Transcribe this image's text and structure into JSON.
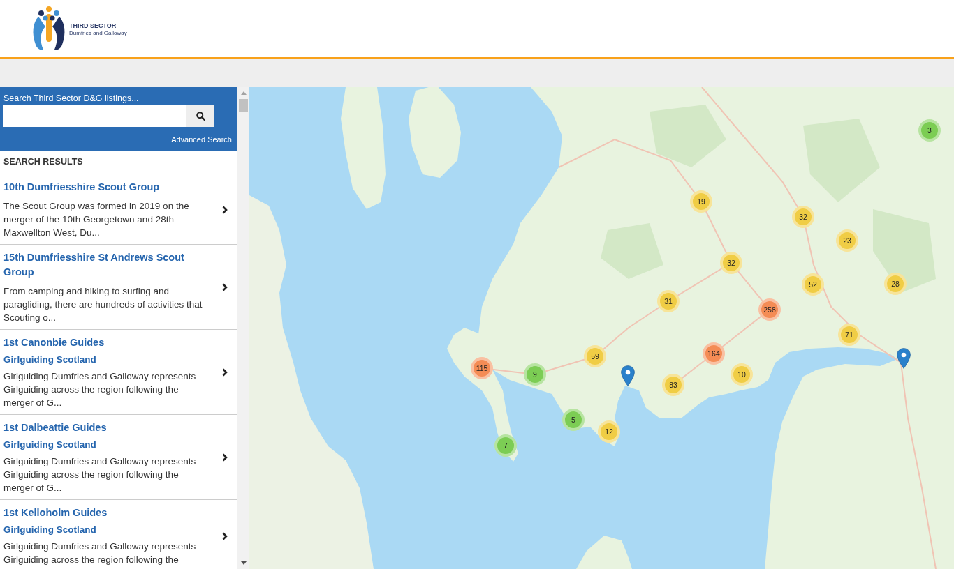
{
  "header": {
    "logo": {
      "title": "THIRD SECTOR",
      "subtitle": "Dumfries and Galloway"
    }
  },
  "search": {
    "label": "Search Third Sector D&G listings...",
    "advanced_link": "Advanced Search"
  },
  "results": {
    "heading": "SEARCH RESULTS",
    "items": [
      {
        "title": "10th Dumfriesshire Scout Group",
        "description": "The Scout Group was formed in 2019 on the merger of the 10th Georgetown and 28th Maxwellton West, Du..."
      },
      {
        "title": "15th Dumfriesshire St Andrews Scout Group",
        "description": "From camping and hiking to surfing and paragliding, there are hundreds of activities that Scouting o..."
      },
      {
        "title": "1st Canonbie Guides",
        "organisation": "Girlguiding Scotland",
        "description": "Girlguiding Dumfries and Galloway represents Girlguiding across the region following the merger of G..."
      },
      {
        "title": "1st Dalbeattie Guides",
        "organisation": "Girlguiding Scotland",
        "description": "Girlguiding Dumfries and Galloway represents Girlguiding across the region following the merger of G..."
      },
      {
        "title": "1st Kelloholm Guides",
        "organisation": "Girlguiding Scotland",
        "description": "Girlguiding Dumfries and Galloway represents Girlguiding across the region following the"
      }
    ]
  },
  "map": {
    "markers": [
      {
        "kind": "cluster",
        "count": "3",
        "color": "#7ccd54"
      },
      {
        "kind": "cluster",
        "count": "19",
        "color": "#f0cd45"
      },
      {
        "kind": "cluster",
        "count": "32",
        "color": "#f0cd45"
      },
      {
        "kind": "cluster",
        "count": "23",
        "color": "#f0cd45"
      },
      {
        "kind": "cluster",
        "count": "32",
        "color": "#f0cd45"
      },
      {
        "kind": "cluster",
        "count": "52",
        "color": "#f0cd45"
      },
      {
        "kind": "cluster",
        "count": "28",
        "color": "#f0cd45"
      },
      {
        "kind": "cluster",
        "count": "31",
        "color": "#f0cd45"
      },
      {
        "kind": "cluster",
        "count": "258",
        "color": "#f48c55"
      },
      {
        "kind": "cluster",
        "count": "71",
        "color": "#f0cd45"
      },
      {
        "kind": "cluster",
        "count": "164",
        "color": "#f48c55"
      },
      {
        "kind": "cluster",
        "count": "59",
        "color": "#f0cd45"
      },
      {
        "kind": "pin"
      },
      {
        "kind": "cluster",
        "count": "115",
        "color": "#f48c55"
      },
      {
        "kind": "cluster",
        "count": "9",
        "color": "#7ccd54"
      },
      {
        "kind": "cluster",
        "count": "10",
        "color": "#f0cd45"
      },
      {
        "kind": "pin"
      },
      {
        "kind": "cluster",
        "count": "83",
        "color": "#f0cd45"
      },
      {
        "kind": "cluster",
        "count": "5",
        "color": "#7ccd54"
      },
      {
        "kind": "cluster",
        "count": "12",
        "color": "#f0cd45"
      },
      {
        "kind": "cluster",
        "count": "7",
        "color": "#7ccd54"
      }
    ]
  }
}
